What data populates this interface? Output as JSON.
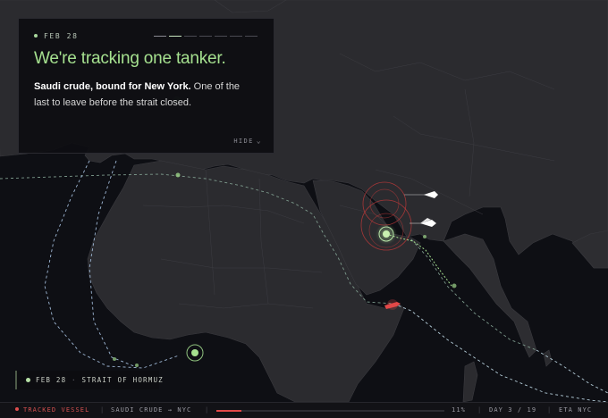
{
  "panel": {
    "date": "FEB 28",
    "steps_total": 7,
    "steps_active": 2,
    "headline": "We're tracking one tanker.",
    "body_bold": "Saudi crude, bound for New York.",
    "body_rest": " One of the last to leave before the strait closed.",
    "hide_label": "HIDE",
    "hide_icon": "chevron-down-icon"
  },
  "location_tag": {
    "date": "FEB 28",
    "separator": "·",
    "place": "STRAIT OF HORMUZ"
  },
  "status_bar": {
    "tracked": "TRACKED VESSEL",
    "route": "SAUDI CRUDE → NYC",
    "progress_percent": "11%",
    "progress_value": 0.11,
    "day": "DAY 3 / 19",
    "eta": "ETA NYC"
  },
  "colors": {
    "accent_green": "#a5e08f",
    "alert_red": "#e24848",
    "background": "#0d0d11"
  }
}
